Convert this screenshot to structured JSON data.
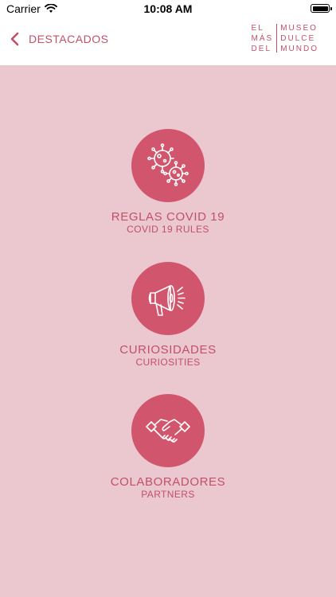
{
  "status_bar": {
    "carrier": "Carrier",
    "time": "10:08 AM"
  },
  "nav": {
    "back_label": "DESTACADOS",
    "logo": {
      "left": [
        "EL",
        "MÁS",
        "DEL"
      ],
      "right": [
        "MUSEO",
        "DULCE",
        "MUNDO"
      ]
    }
  },
  "items": [
    {
      "title": "REGLAS COVID 19",
      "subtitle": "COVID 19 RULES",
      "icon": "virus-icon"
    },
    {
      "title": "CURIOSIDADES",
      "subtitle": "CURIOSITIES",
      "icon": "megaphone-icon"
    },
    {
      "title": "COLABORADORES",
      "subtitle": "PARTNERS",
      "icon": "handshake-icon"
    }
  ],
  "colors": {
    "accent": "#c2506a",
    "circle": "#d1566d",
    "background": "#ebc7cf"
  }
}
